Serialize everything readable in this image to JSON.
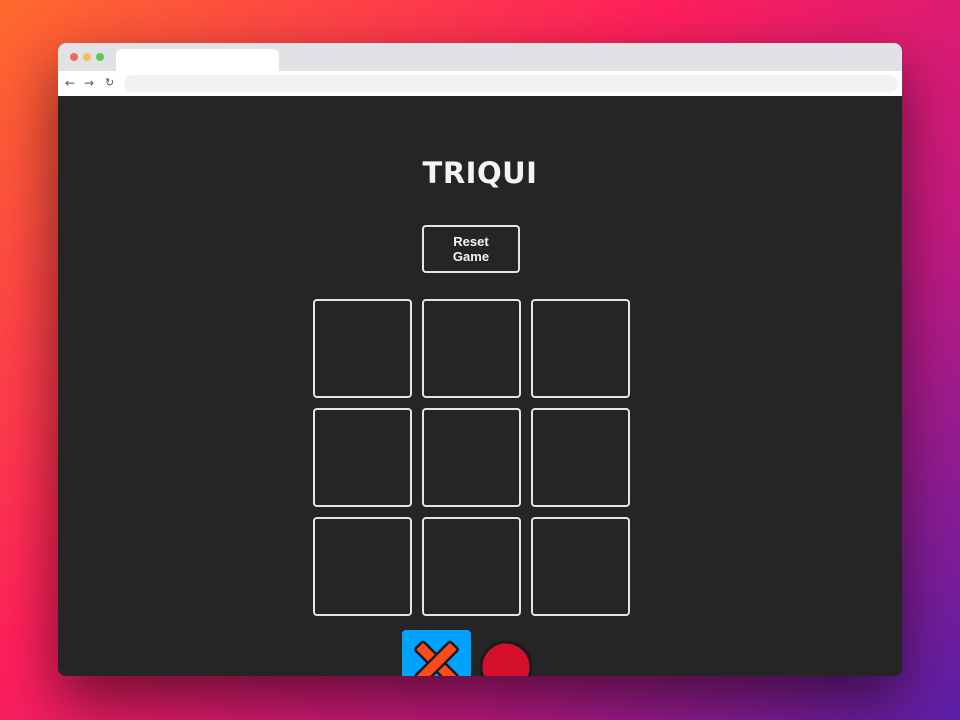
{
  "game": {
    "title": "TRIQUI",
    "reset_label": "Reset Game",
    "board": [
      [
        "",
        "",
        ""
      ],
      [
        "",
        "",
        ""
      ],
      [
        "",
        "",
        ""
      ]
    ],
    "players": [
      {
        "symbol": "cross-icon",
        "selected": true,
        "color": "#ff4a1c"
      },
      {
        "symbol": "circle-icon",
        "selected": false,
        "color": "#d4102c"
      }
    ],
    "colors": {
      "background": "#252525",
      "border": "#e4e4e4",
      "selected_player": "#00a2ff"
    }
  }
}
